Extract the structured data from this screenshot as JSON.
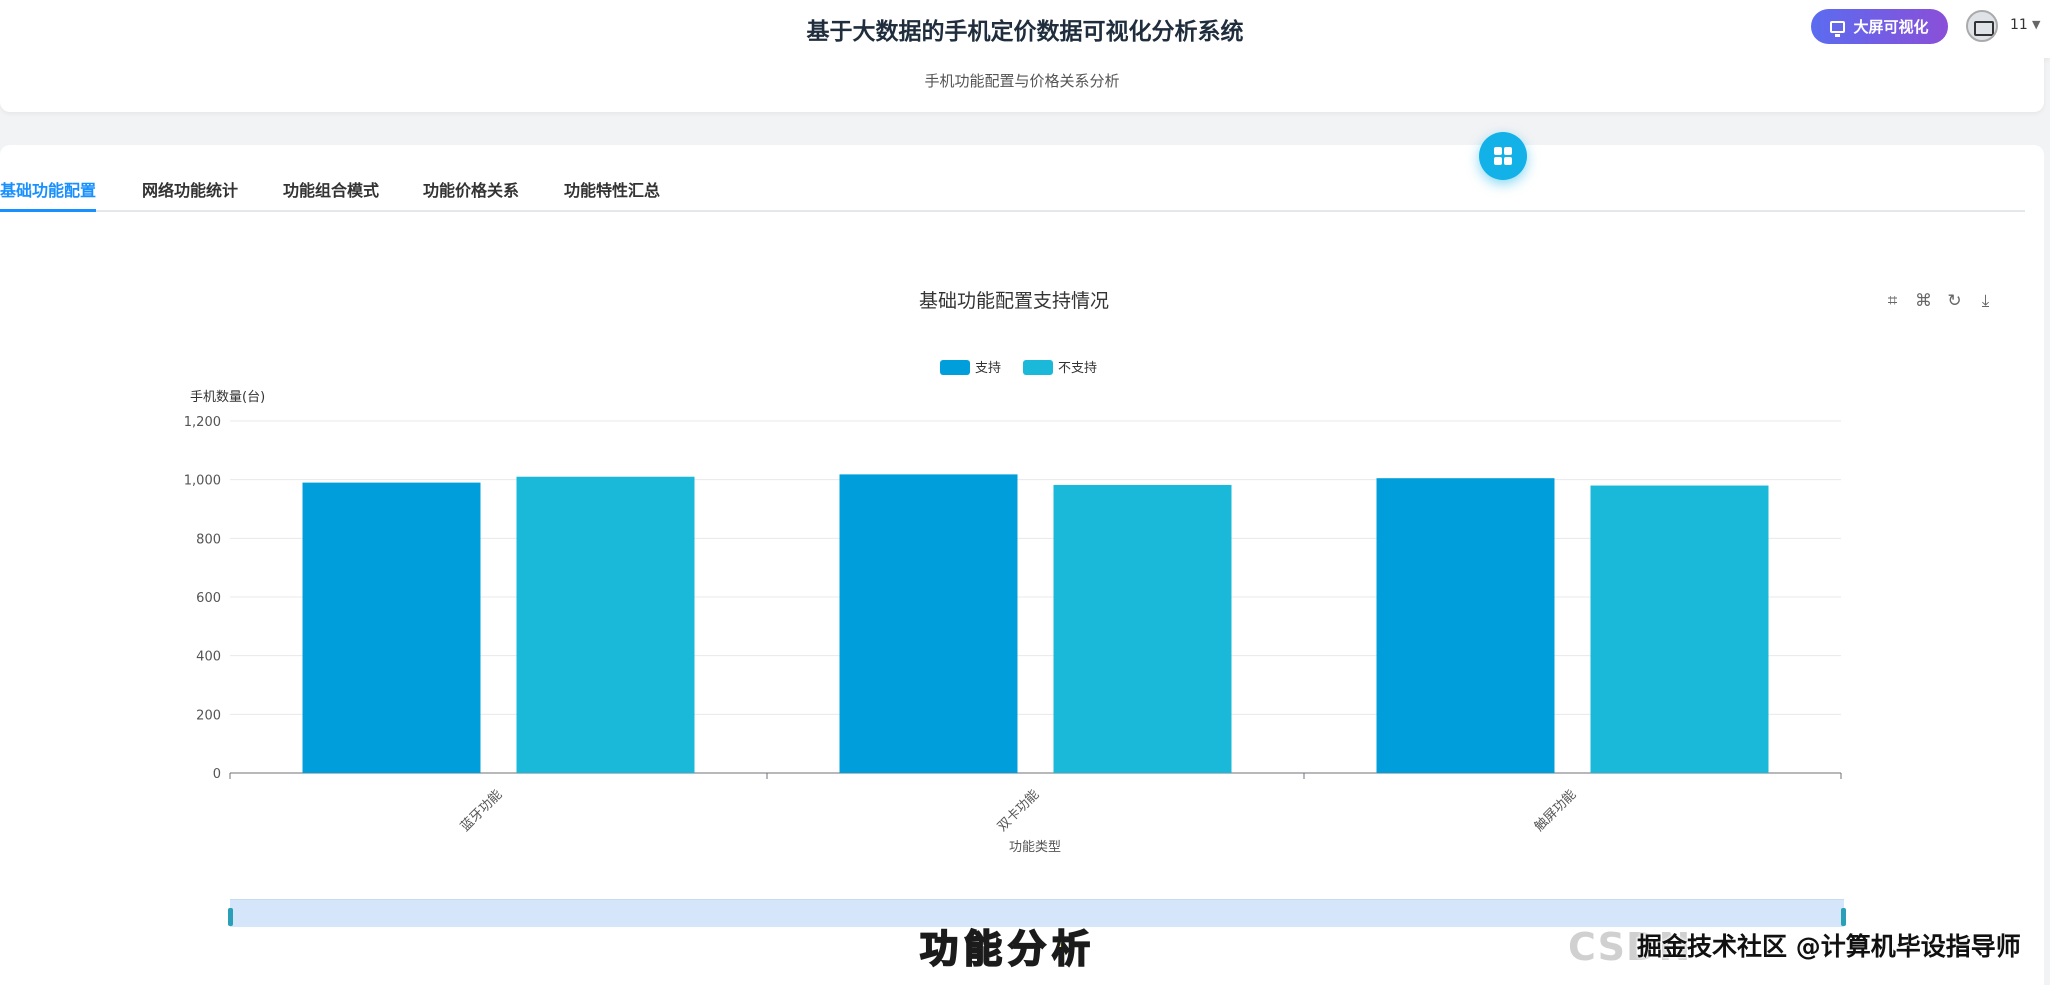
{
  "header": {
    "title": "基于大数据的手机定价数据可视化分析系统",
    "big_screen_label": "大屏可视化",
    "user_name": "11"
  },
  "subtitle": "手机功能配置与价格关系分析",
  "tabs": [
    {
      "label": "基础功能配置",
      "active": true
    },
    {
      "label": "网络功能统计",
      "active": false
    },
    {
      "label": "功能组合模式",
      "active": false
    },
    {
      "label": "功能价格关系",
      "active": false
    },
    {
      "label": "功能特性汇总",
      "active": false
    }
  ],
  "toolbox": [
    "crop-icon",
    "restore-crop-icon",
    "refresh-icon",
    "download-icon"
  ],
  "chart_data": {
    "type": "bar",
    "title": "基础功能配置支持情况",
    "xlabel": "功能类型",
    "ylabel": "手机数量(台)",
    "categories": [
      "蓝牙功能",
      "双卡功能",
      "触屏功能"
    ],
    "series": [
      {
        "name": "支持",
        "values": [
          990,
          1018,
          1005
        ],
        "color": "#009fdb"
      },
      {
        "name": "不支持",
        "values": [
          1010,
          982,
          980
        ],
        "color": "#1ab9d9"
      }
    ],
    "yticks": [
      "0",
      "200",
      "400",
      "600",
      "800",
      "1,000",
      "1,200"
    ],
    "ylim": [
      0,
      1200
    ],
    "grid": true,
    "legend_position": "top-center"
  },
  "overlay_caption": "功能分析",
  "watermark_ghost": "CSDN",
  "watermark": "掘金技术社区 @计算机毕设指导师",
  "colors": {
    "accent": "#1890ff",
    "fab": "#12b1e8",
    "button_gradient": [
      "#5b6cf0",
      "#8a4fd8"
    ]
  }
}
